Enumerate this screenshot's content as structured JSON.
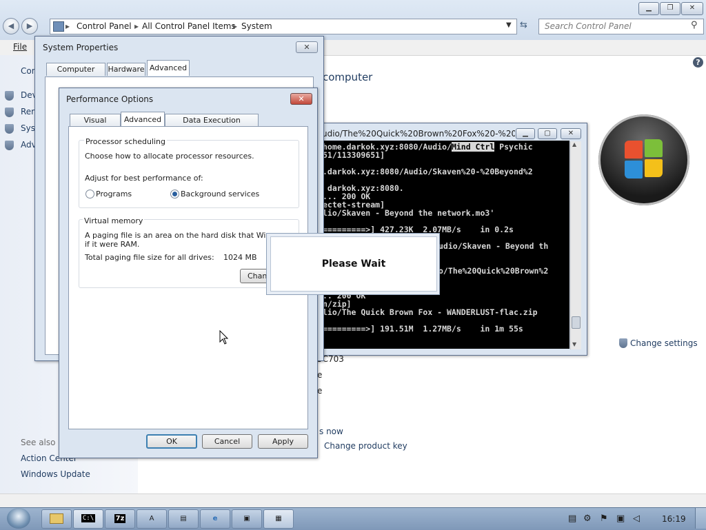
{
  "explorer": {
    "breadcrumbs": [
      "Control Panel",
      "All Control Panel Items",
      "System"
    ],
    "search_placeholder": "Search Control Panel",
    "menu_file": "File",
    "heading_partial": "computer",
    "left_items": [
      "Conti",
      "Devi",
      "Rem",
      "Syst",
      "Adv"
    ],
    "see_also": "See also",
    "see_also_items": [
      "Action Center",
      "Windows Update"
    ],
    "change_settings": "Change settings",
    "frag_model": "5C703",
    "frag_e1": "e",
    "frag_e2": "e",
    "frag_now": "s now",
    "change_product_key": "Change product key"
  },
  "system_properties": {
    "title": "System Properties",
    "tabs": [
      "Computer Name",
      "Hardware",
      "Advanced"
    ]
  },
  "performance_options": {
    "title": "Performance Options",
    "tabs": [
      "Visual Effects",
      "Advanced",
      "Data Execution Prevention"
    ],
    "processor_scheduling": {
      "legend": "Processor scheduling",
      "description": "Choose how to allocate processor resources.",
      "adjust_label": "Adjust for best performance of:",
      "option_programs": "Programs",
      "option_background": "Background services",
      "selected": "Background services"
    },
    "virtual_memory": {
      "legend": "Virtual memory",
      "line1": "A paging file is an area on the hard disk that Windows u",
      "line2": "if it were RAM.",
      "total_label": "Total paging file size for all drives:",
      "total_value": "1024 MB",
      "change_button": "Chan"
    },
    "buttons": {
      "ok": "OK",
      "cancel": "Cancel",
      "apply": "Apply"
    }
  },
  "console": {
    "title": "udio/The%20Quick%20Brown%20Fox%20-%20WA...",
    "lines": [
      {
        "pre": "home.darkok.xyz:8080/Audio/",
        "hl": "Mind Ctrl",
        "post": " Psychic"
      },
      {
        "pre": "51/113309651]",
        "hl": "",
        "post": ""
      },
      {
        "pre": "",
        "hl": "",
        "post": ""
      },
      {
        "pre": ".darkok.xyz:8080/Audio/Skaven%20-%20Beyond%2",
        "hl": "",
        "post": ""
      },
      {
        "pre": "",
        "hl": "",
        "post": ""
      },
      {
        "pre": " darkok.xyz:8080.",
        "hl": "",
        "post": ""
      },
      {
        "pre": "... 200 OK",
        "hl": "",
        "post": ""
      },
      {
        "pre": "ectet-stream]",
        "hl": "",
        "post": ""
      },
      {
        "pre": "lio/Skaven - Beyond the network.mo3'",
        "hl": "",
        "post": ""
      },
      {
        "pre": "",
        "hl": "",
        "post": ""
      },
      {
        "pre": "=========>] 427.23K  2.07MB/s    in 0.2s",
        "hl": "",
        "post": ""
      },
      {
        "pre": "",
        "hl": "",
        "post": ""
      },
      {
        "pre": "",
        "hl": "",
        "post": "udio/Skaven - Beyond th"
      },
      {
        "pre": "",
        "hl": "",
        "post": ""
      },
      {
        "pre": "",
        "hl": "",
        "post": ""
      },
      {
        "pre": "",
        "hl": "",
        "post": "o/The%20Quick%20Brown%2"
      },
      {
        "pre": "",
        "hl": "",
        "post": ""
      },
      {
        "pre": "",
        "hl": "",
        "post": ""
      },
      {
        "pre": ".. 200 OK",
        "hl": "",
        "post": ""
      },
      {
        "pre": "n/zip]",
        "hl": "",
        "post": ""
      },
      {
        "pre": "lio/The Quick Brown Fox - WANDERLUST-flac.zip",
        "hl": "",
        "post": ""
      },
      {
        "pre": "",
        "hl": "",
        "post": ""
      },
      {
        "pre": "=========>] 191.51M  1.27MB/s    in 1m 55s",
        "hl": "",
        "post": ""
      }
    ]
  },
  "please_wait": "Please Wait",
  "taskbar": {
    "cmd_label": "C:\\",
    "sevenzip_label": "7z",
    "clock": "16:19"
  }
}
